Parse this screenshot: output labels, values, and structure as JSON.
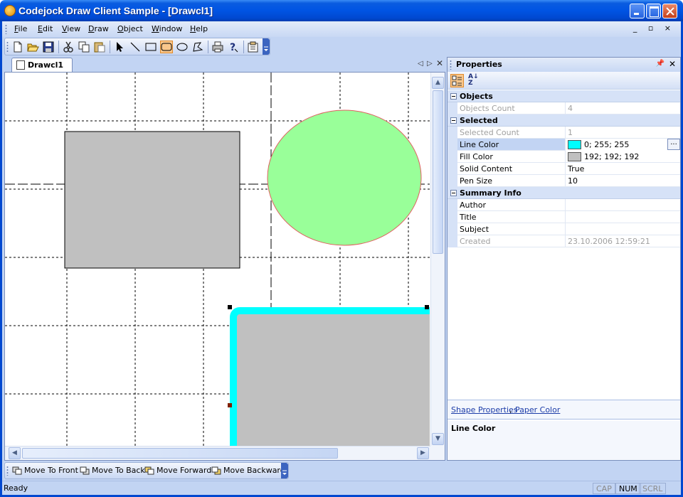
{
  "window": {
    "title": "Codejock Draw Client Sample - [Drawcl1]"
  },
  "menu": [
    {
      "label": "File",
      "key": "F",
      "rest": "ile"
    },
    {
      "label": "Edit",
      "key": "E",
      "rest": "dit"
    },
    {
      "label": "View",
      "key": "V",
      "rest": "iew"
    },
    {
      "label": "Draw",
      "key": "D",
      "rest": "raw"
    },
    {
      "label": "Object",
      "key": "O",
      "rest": "bject"
    },
    {
      "label": "Window",
      "key": "W",
      "rest": "indow"
    },
    {
      "label": "Help",
      "key": "H",
      "rest": "elp"
    }
  ],
  "mdi_controls": "_ ▫ ×",
  "toolbar": {
    "icons": [
      "new-icon",
      "open-icon",
      "save-icon",
      "cut-icon",
      "copy-icon",
      "paste-icon",
      "select-arrow-icon",
      "line-tool-icon",
      "rectangle-tool-icon",
      "rounded-rect-tool-icon",
      "ellipse-tool-icon",
      "polygon-tool-icon",
      "print-icon",
      "help-icon",
      "properties-icon"
    ],
    "active_tool": "rounded-rect-tool-icon"
  },
  "document": {
    "tab_label": "Drawcl1",
    "shapes": {
      "rect1_fill": "#c0c0c0",
      "ellipse_fill": "#99ff99",
      "ellipse_line": "#e06060",
      "roundrect_fill": "#c0c0c0",
      "roundrect_line": "#00ffff"
    }
  },
  "properties": {
    "title": "Properties",
    "categories": [
      {
        "name": "Objects",
        "rows": [
          {
            "name": "Objects Count",
            "value": "4",
            "readonly": true
          }
        ]
      },
      {
        "name": "Selected",
        "rows": [
          {
            "name": "Selected Count",
            "value": "1",
            "readonly": true
          },
          {
            "name": "Line Color",
            "value": "0; 255; 255",
            "swatch": "#00ffff",
            "selected": true
          },
          {
            "name": "Fill Color",
            "value": "192; 192; 192",
            "swatch": "#c0c0c0"
          },
          {
            "name": "Solid Content",
            "value": "True"
          },
          {
            "name": "Pen Size",
            "value": "10"
          }
        ]
      },
      {
        "name": "Summary Info",
        "rows": [
          {
            "name": "Author",
            "value": ""
          },
          {
            "name": "Title",
            "value": ""
          },
          {
            "name": "Subject",
            "value": ""
          },
          {
            "name": "Created",
            "value": "23.10.2006 12:59:21",
            "readonly": true
          }
        ]
      }
    ],
    "links": {
      "shape": "Shape Properties",
      "comma": ",",
      "paper": "Paper Color"
    },
    "help_title": "Line Color"
  },
  "bottom_toolbar": [
    {
      "label": "Move To Front",
      "icon": "move-to-front-icon"
    },
    {
      "label": "Move To Back",
      "icon": "move-to-back-icon"
    },
    {
      "label": "Move Forward",
      "icon": "move-forward-icon"
    },
    {
      "label": "Move Backward",
      "icon": "move-backward-icon"
    }
  ],
  "status": {
    "text": "Ready",
    "indicators": [
      {
        "label": "CAP",
        "on": false
      },
      {
        "label": "NUM",
        "on": true
      },
      {
        "label": "SCRL",
        "on": false
      }
    ]
  }
}
